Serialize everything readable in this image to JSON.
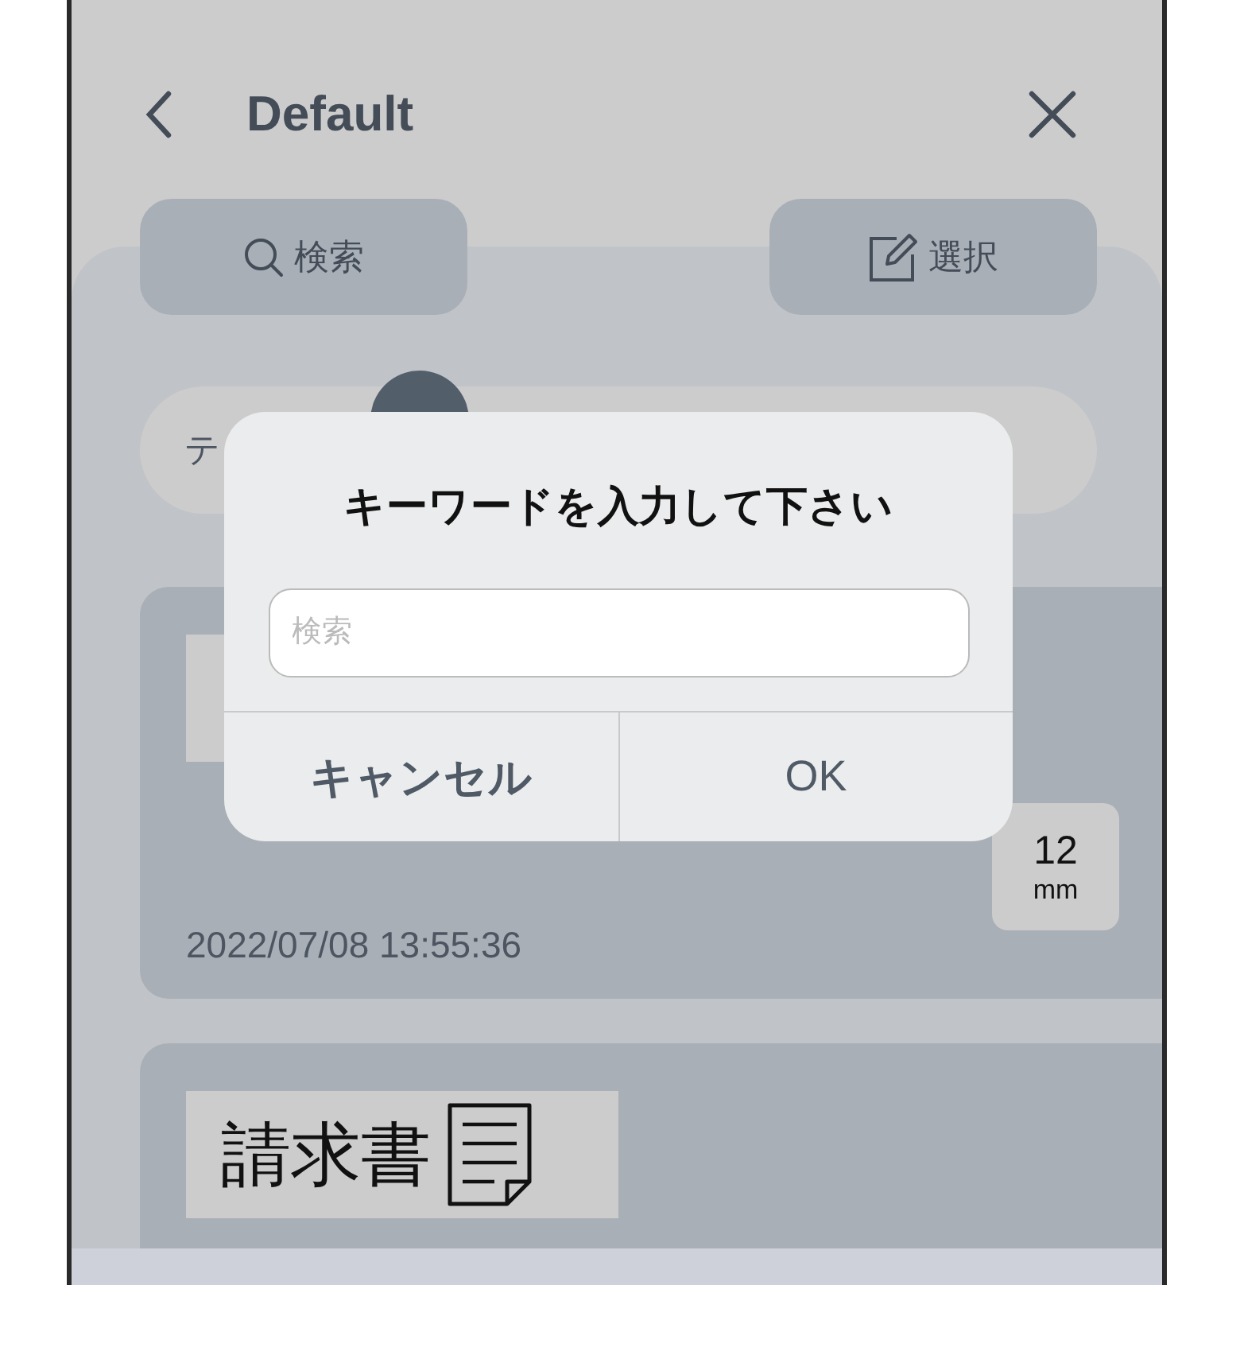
{
  "header": {
    "title": "Default"
  },
  "toolbar": [
    {
      "label": "検索",
      "kind": "search"
    },
    {
      "label": "選択",
      "kind": "edit"
    }
  ],
  "filter": {
    "label": "テ"
  },
  "labels": [
    {
      "kind": "blank",
      "date": "2022/07/08 13:55:36",
      "size": "12",
      "unit": "mm"
    },
    {
      "kind": "invoice",
      "preview": "請求書"
    }
  ],
  "dialog": {
    "title": "キーワードを入力して下さい",
    "placeholder": "検索",
    "buttons": [
      {
        "label": "キャンセル",
        "kind": "cancel"
      },
      {
        "label": "OK",
        "kind": "ok"
      }
    ]
  }
}
